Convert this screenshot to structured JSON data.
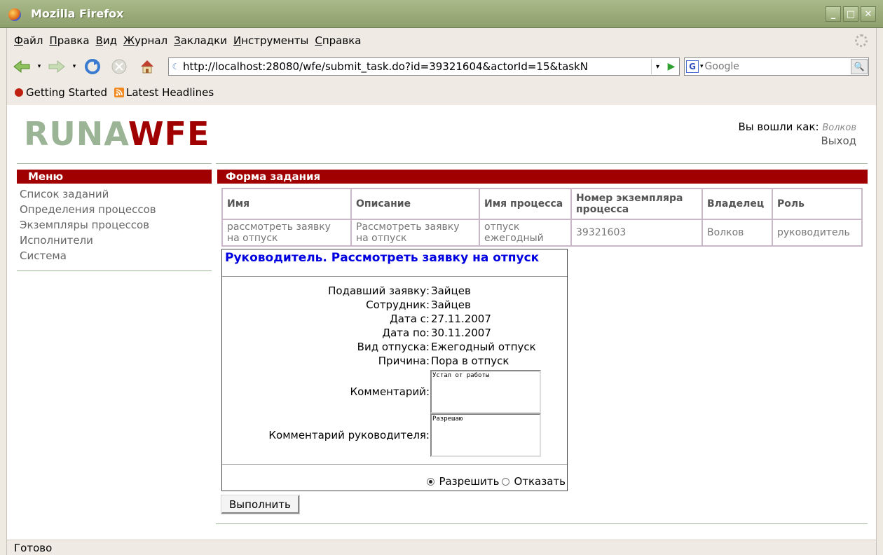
{
  "window": {
    "title": "Mozilla Firefox",
    "buttons": [
      "_",
      "□",
      "✕"
    ]
  },
  "menubar": [
    {
      "u": "Ф",
      "rest": "айл"
    },
    {
      "u": "П",
      "rest": "равка"
    },
    {
      "u": "В",
      "rest": "ид"
    },
    {
      "u": "Ж",
      "rest": "урнал"
    },
    {
      "u": "З",
      "rest": "акладки"
    },
    {
      "u": "И",
      "rest": "нструменты"
    },
    {
      "u": "С",
      "rest": "правка"
    }
  ],
  "navbar": {
    "url": "http://localhost:28080/wfe/submit_task.do?id=39321604&actorId=15&taskN",
    "search_placeholder": "Google"
  },
  "bookmarks": {
    "getting_started": "Getting Started",
    "latest_headlines": "Latest Headlines"
  },
  "header": {
    "logo_left": "RUNA",
    "logo_right": "WFE",
    "logged_in_label": "Вы вошли как:",
    "user": "Волков",
    "logout": "Выход"
  },
  "menu": {
    "title": "Меню",
    "items": [
      "Список заданий",
      "Определения процессов",
      "Экземпляры процессов",
      "Исполнители",
      "Система"
    ]
  },
  "form_header": "Форма задания",
  "task_table": {
    "headers": [
      "Имя",
      "Описание",
      "Имя процесса",
      "Номер экземпляра процесса",
      "Владелец",
      "Роль"
    ],
    "row": [
      "рассмотреть заявку на отпуск",
      "Рассмотреть заявку на отпуск",
      "отпуск ежегодный",
      "39321603",
      "Волков",
      "руководитель"
    ]
  },
  "task_form": {
    "title": "Руководитель. Рассмотреть заявку на отпуск",
    "fields": [
      {
        "label": "Подавший заявку:",
        "value": "Зайцев"
      },
      {
        "label": "Сотрудник:",
        "value": "Зайцев"
      },
      {
        "label": "Дата с:",
        "value": "27.11.2007"
      },
      {
        "label": "Дата по:",
        "value": "30.11.2007"
      },
      {
        "label": "Вид отпуска:",
        "value": "Ежегодный отпуск"
      },
      {
        "label": "Причина:",
        "value": "Пора в отпуск"
      }
    ],
    "comment_label": "Комментарий:",
    "comment_value": "Устал от работы",
    "manager_comment_label": "Комментарий руководителя:",
    "manager_comment_value": "Разрешаю",
    "approve_label": "Разрешить",
    "reject_label": "Отказать"
  },
  "submit_label": "Выполнить",
  "status": "Готово"
}
